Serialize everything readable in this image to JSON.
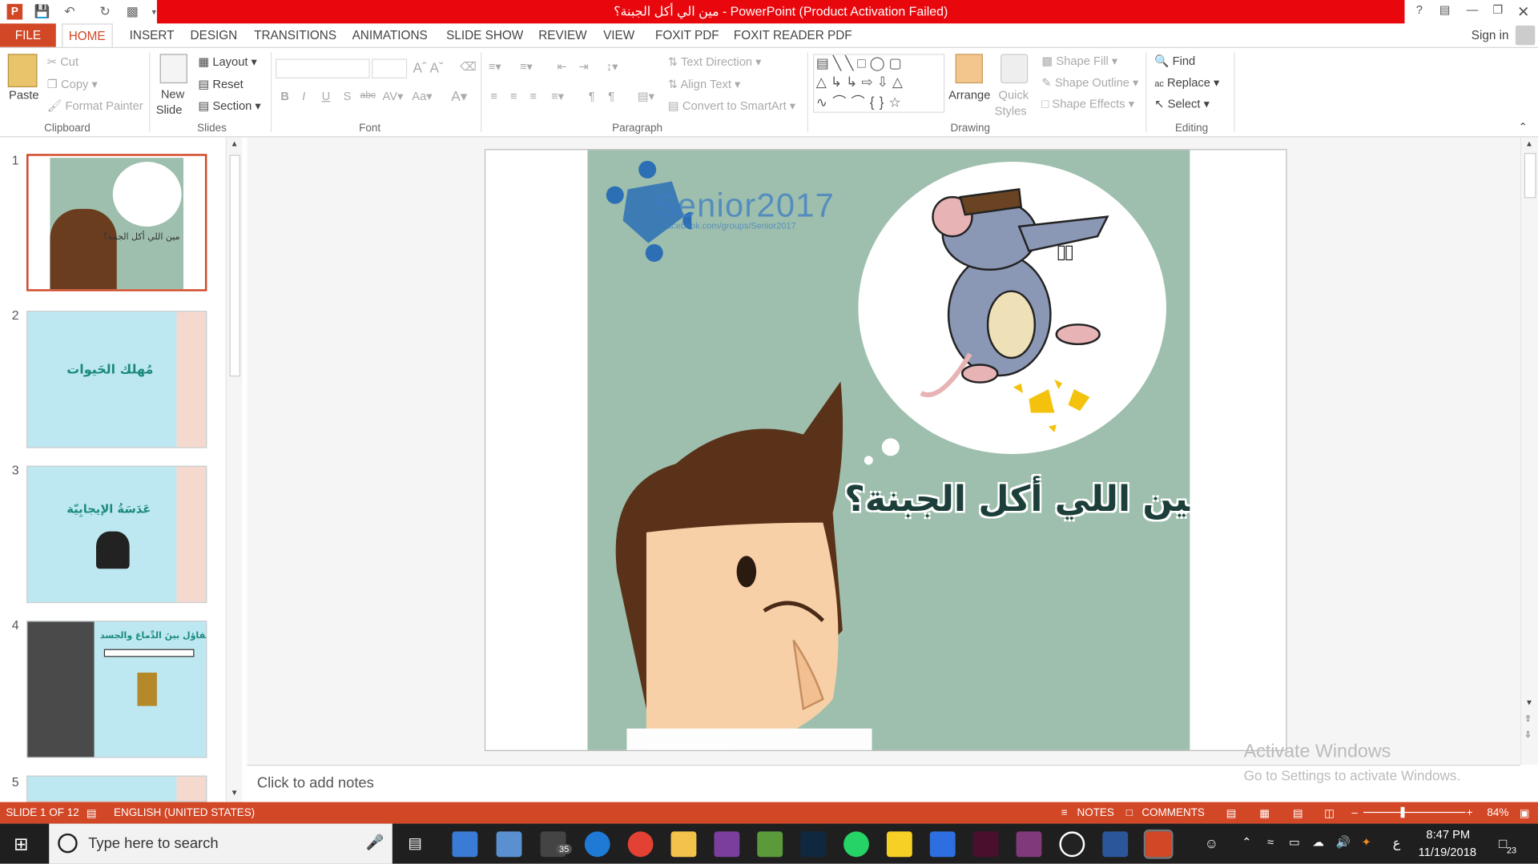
{
  "window": {
    "title": "مين الي أكل الجبنة؟  -  PowerPoint (Product Activation Failed)",
    "help": "?",
    "sign_in": "Sign in"
  },
  "tabs": [
    "FILE",
    "HOME",
    "INSERT",
    "DESIGN",
    "TRANSITIONS",
    "ANIMATIONS",
    "SLIDE SHOW",
    "REVIEW",
    "VIEW",
    "FOXIT PDF",
    "FOXIT READER PDF"
  ],
  "ribbon": {
    "clipboard": {
      "paste": "Paste",
      "cut": "Cut",
      "copy": "Copy",
      "format_painter": "Format Painter",
      "label": "Clipboard"
    },
    "slides": {
      "new_slide": "New",
      "new_slide2": "Slide",
      "layout": "Layout",
      "reset": "Reset",
      "section": "Section",
      "label": "Slides"
    },
    "font": {
      "label": "Font",
      "bold": "B",
      "italic": "I",
      "underline": "U",
      "shadow": "S",
      "strike": "abc"
    },
    "paragraph": {
      "text_direction": "Text Direction",
      "align_text": "Align Text",
      "convert_smartart": "Convert to SmartArt",
      "label": "Paragraph"
    },
    "drawing": {
      "arrange": "Arrange",
      "quick_styles": "Quick",
      "quick_styles2": "Styles",
      "shape_fill": "Shape Fill",
      "shape_outline": "Shape Outline",
      "shape_effects": "Shape Effects",
      "label": "Drawing"
    },
    "editing": {
      "find": "Find",
      "replace": "Replace",
      "select": "Select",
      "label": "Editing"
    }
  },
  "thumbnails": [
    {
      "num": "1",
      "text": "مين اللي أكل الجبنة؟",
      "selected": true
    },
    {
      "num": "2",
      "text": "مُهلك الحَيوات"
    },
    {
      "num": "3",
      "text": "عَدَسَةُ الإيجابِيّة"
    },
    {
      "num": "4",
      "text": "التَّفاؤل بينَ الدِّماغ والجسد"
    },
    {
      "num": "5",
      "text": ""
    }
  ],
  "slide": {
    "title": "مين اللي أكل الجبنة؟",
    "logo": "Senior2017",
    "logo_url": "facebook.com/groups/Senior2017"
  },
  "notes_placeholder": "Click to add notes",
  "activation": {
    "line1": "Activate Windows",
    "line2": "Go to Settings to activate Windows."
  },
  "status": {
    "slide": "SLIDE 1 OF 12",
    "language": "ENGLISH (UNITED STATES)",
    "notes": "NOTES",
    "comments": "COMMENTS",
    "zoom": "84%"
  },
  "taskbar": {
    "search": "Type here to search",
    "time": "8:47 PM",
    "date": "11/19/2018",
    "notif": "23",
    "mail_badge": "35",
    "lang": "ع"
  },
  "colors": {
    "accent": "#d24726",
    "title_red": "#e8070c",
    "slide_bg": "#9ebfad"
  }
}
